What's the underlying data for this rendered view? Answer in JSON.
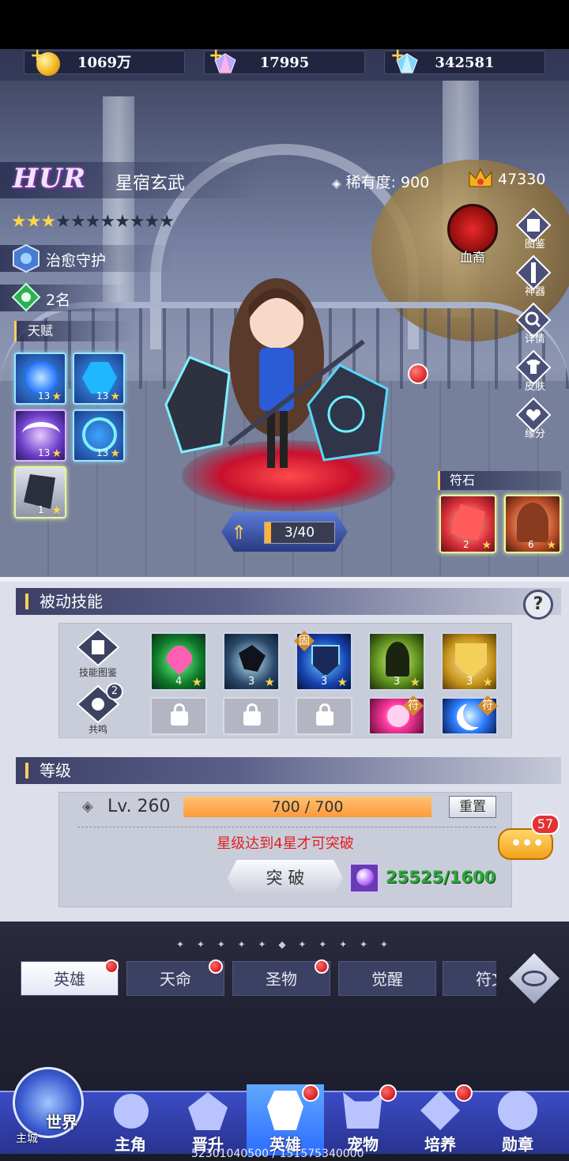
{
  "currency": {
    "gold": "1069万",
    "crystal": "17995",
    "diamond": "342581"
  },
  "hero": {
    "grade": "HUR",
    "name": "星宿玄武",
    "rarity_label": "稀有度:",
    "rarity_value": "900",
    "power": "47330",
    "stars_filled": 3,
    "stars_total": 11,
    "role": "治愈守护",
    "rank": "2名",
    "level_display": "3/40"
  },
  "talent": {
    "title": "天赋",
    "slots": [
      {
        "level": "13",
        "icon": "blue-orb-icon"
      },
      {
        "level": "13",
        "icon": "blue-hex-icon"
      },
      {
        "level": "13",
        "icon": "purple-wave-icon"
      },
      {
        "level": "13",
        "icon": "blue-rune-icon"
      },
      {
        "level": "1",
        "icon": "shield-fragment-icon"
      }
    ]
  },
  "faction": {
    "label": "血裔"
  },
  "side_menu": [
    "图鉴",
    "神器",
    "详情",
    "皮肤",
    "缘分"
  ],
  "rune": {
    "title": "符石",
    "slots": [
      {
        "level": "2"
      },
      {
        "level": "6"
      }
    ]
  },
  "passive": {
    "title": "被动技能",
    "help": "?",
    "side_buttons": [
      "技能图鉴",
      "共鸣"
    ],
    "resonance_badge": "2",
    "skills": [
      {
        "level": "4",
        "icon": "heart-icon",
        "locked": false
      },
      {
        "level": "3",
        "icon": "shatter-icon",
        "locked": false
      },
      {
        "level": "3",
        "icon": "shield-icon",
        "locked": false,
        "badge": "固"
      },
      {
        "level": "3",
        "icon": "silhouette-icon",
        "locked": false
      },
      {
        "level": "3",
        "icon": "gold-shield-icon",
        "locked": false
      },
      {
        "icon": "lock-icon",
        "locked": true
      },
      {
        "icon": "lock-icon",
        "locked": true
      },
      {
        "icon": "lock-icon",
        "locked": true
      },
      {
        "icon": "pink-burst-icon",
        "locked": false,
        "badge": "符"
      },
      {
        "icon": "blue-moon-icon",
        "locked": false,
        "badge": "符"
      }
    ]
  },
  "levelsec": {
    "title": "等级",
    "level": "Lv. 260",
    "exp": "700 / 700",
    "exp_fraction": 1.0,
    "reset": "重置",
    "warning": "星级达到4星才可突破",
    "breakthrough": "突 破",
    "cost": "25525/1600"
  },
  "chat_badge": "57",
  "tabs": [
    "英雄",
    "天命",
    "圣物",
    "觉醒",
    "符文"
  ],
  "nav": {
    "world": "世界",
    "city": "主城",
    "items": [
      "主角",
      "晋升",
      "英雄",
      "宠物",
      "培养",
      "勋章"
    ]
  },
  "footer_text": "52301040500 / 151575340000"
}
